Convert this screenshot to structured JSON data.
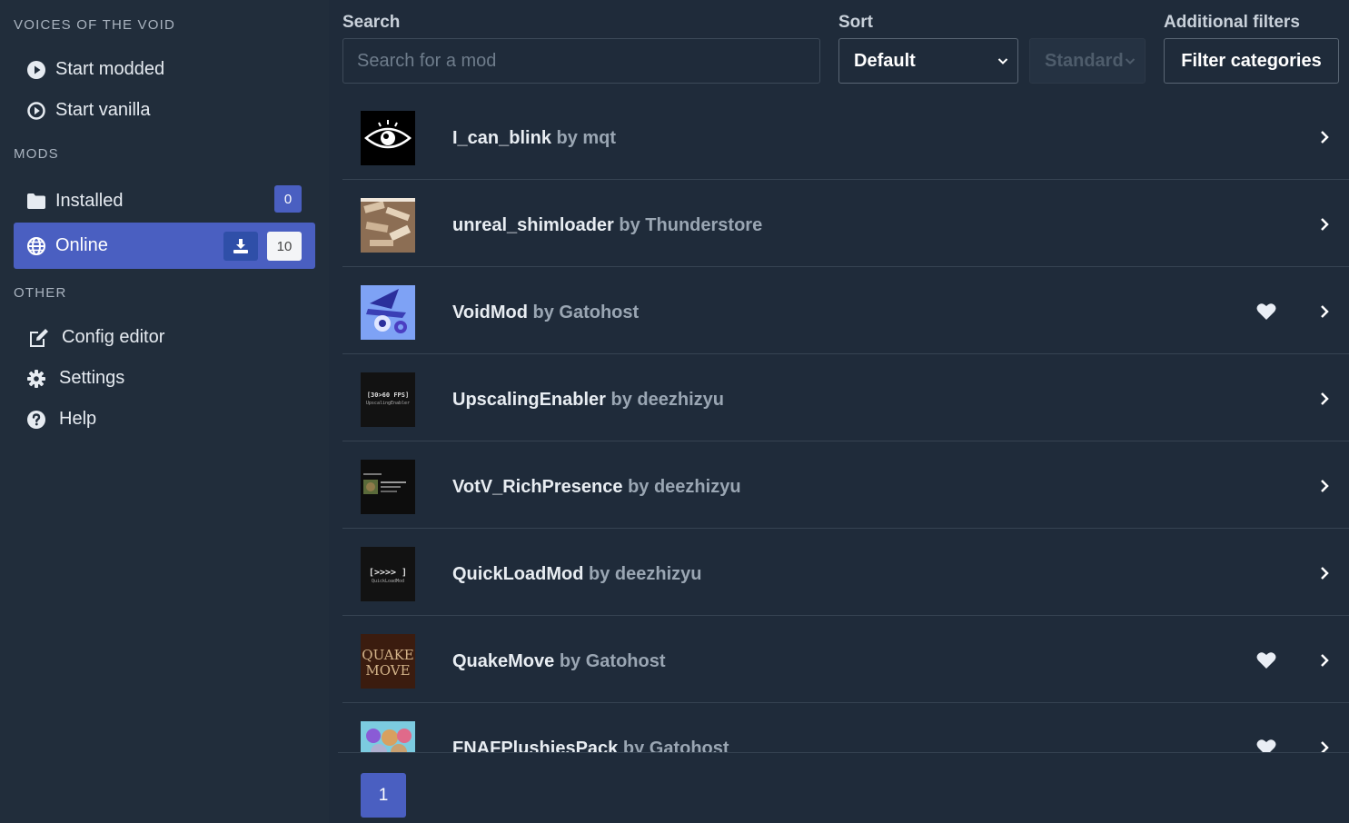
{
  "sidebar": {
    "game_title": "VOICES OF THE VOID",
    "game_items": [
      {
        "label": "Start modded",
        "icon": "play-circle-icon"
      },
      {
        "label": "Start vanilla",
        "icon": "play-circle-outline-icon"
      }
    ],
    "mods_label": "MODS",
    "installed": {
      "label": "Installed",
      "count": "0",
      "icon": "folder-icon"
    },
    "online": {
      "label": "Online",
      "count": "10",
      "icon": "globe-icon"
    },
    "other_label": "OTHER",
    "other_items": [
      {
        "label": "Config editor",
        "icon": "edit-icon"
      },
      {
        "label": "Settings",
        "icon": "gear-icon"
      },
      {
        "label": "Help",
        "icon": "question-circle-icon"
      }
    ]
  },
  "toolbar": {
    "search_label": "Search",
    "search_placeholder": "Search for a mod",
    "sort_label": "Sort",
    "sort_value": "Default",
    "sort_direction": "Standard",
    "filters_label": "Additional filters",
    "filter_button": "Filter categories"
  },
  "mods": [
    {
      "name": "I_can_blink",
      "by": "by mqt",
      "liked": false
    },
    {
      "name": "unreal_shimloader",
      "by": "by Thunderstore",
      "liked": false
    },
    {
      "name": "VoidMod",
      "by": "by Gatohost",
      "liked": true
    },
    {
      "name": "UpscalingEnabler",
      "by": "by deezhizyu",
      "liked": false
    },
    {
      "name": "VotV_RichPresence",
      "by": "by deezhizyu",
      "liked": false
    },
    {
      "name": "QuickLoadMod",
      "by": "by deezhizyu",
      "liked": false
    },
    {
      "name": "QuakeMove",
      "by": "by Gatohost",
      "liked": true
    },
    {
      "name": "FNAFPlushiesPack",
      "by": "by Gatohost",
      "liked": true
    }
  ],
  "thumb_text": {
    "upscaling_line1": "[30>60 FPS]",
    "upscaling_line2": "UpscalingEnabler",
    "quickload_line1": "[>>>> ]",
    "quickload_line2": "QuickLoadMod",
    "quake_line1": "QUAKE",
    "quake_line2": "MOVE"
  },
  "pagination": {
    "current": "1"
  },
  "colors": {
    "accent": "#4a5fc1",
    "background": "#1f2b3a"
  }
}
